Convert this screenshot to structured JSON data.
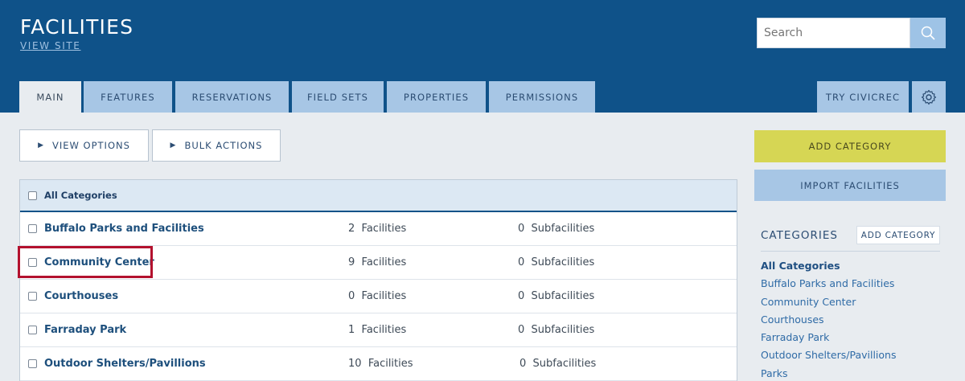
{
  "header": {
    "title": "FACILITIES",
    "view_site": "VIEW SITE",
    "search_placeholder": "Search"
  },
  "tabs": [
    {
      "label": "MAIN",
      "active": true
    },
    {
      "label": "FEATURES"
    },
    {
      "label": "RESERVATIONS"
    },
    {
      "label": "FIELD SETS"
    },
    {
      "label": "PROPERTIES"
    },
    {
      "label": "PERMISSIONS"
    }
  ],
  "try_civicrec": "TRY CIVICREC",
  "toolbar": {
    "view_options": "VIEW OPTIONS",
    "bulk_actions": "BULK ACTIONS"
  },
  "table": {
    "header_label": "All Categories",
    "rows": [
      {
        "name": "Buffalo Parks and Facilities",
        "facilities": "2",
        "facilities_label": "Facilities",
        "subfacilities": "0",
        "subfacilities_label": "Subfacilities"
      },
      {
        "name": "Community Center",
        "facilities": "9",
        "facilities_label": "Facilities",
        "subfacilities": "0",
        "subfacilities_label": "Subfacilities"
      },
      {
        "name": "Courthouses",
        "facilities": "0",
        "facilities_label": "Facilities",
        "subfacilities": "0",
        "subfacilities_label": "Subfacilities"
      },
      {
        "name": "Farraday Park",
        "facilities": "1",
        "facilities_label": "Facilities",
        "subfacilities": "0",
        "subfacilities_label": "Subfacilities"
      },
      {
        "name": "Outdoor Shelters/Pavillions",
        "facilities": "10",
        "facilities_label": "Facilities",
        "subfacilities": "0",
        "subfacilities_label": "Subfacilities"
      }
    ]
  },
  "sidebar": {
    "add_category": "ADD CATEGORY",
    "import_facilities": "IMPORT FACILITIES",
    "categories_heading": "CATEGORIES",
    "categories_add": "ADD CATEGORY",
    "categories": [
      "All Categories",
      "Buffalo Parks and Facilities",
      "Community Center",
      "Courthouses",
      "Farraday Park",
      "Outdoor Shelters/Pavillions",
      "Parks"
    ]
  },
  "colors": {
    "header_bg": "#0f5289",
    "tab_bg": "#a7c6e5",
    "add_button": "#d6d654",
    "highlight": "#b3112e"
  }
}
